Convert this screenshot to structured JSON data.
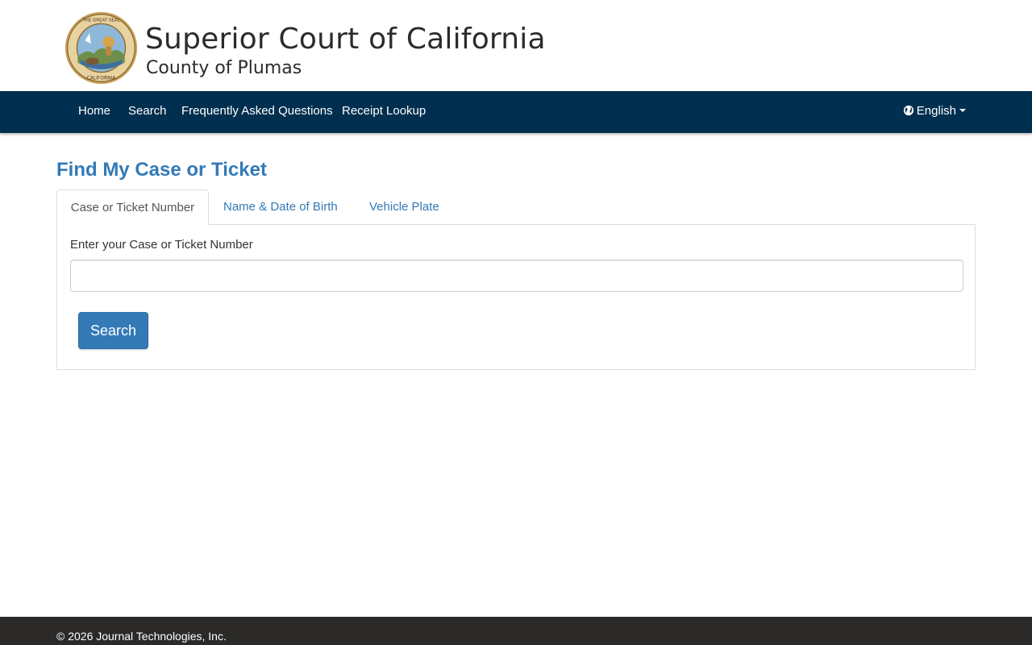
{
  "header": {
    "title": "Superior Court of California",
    "subtitle": "County of Plumas",
    "seal_icon": "california-state-seal"
  },
  "nav": {
    "items": [
      {
        "label": "Home"
      },
      {
        "label": "Search"
      },
      {
        "label": "Frequently Asked Questions"
      },
      {
        "label": "Receipt Lookup"
      }
    ],
    "language": {
      "label": "English",
      "icon": "globe-icon"
    }
  },
  "main": {
    "title": "Find My Case or Ticket",
    "tabs": [
      {
        "label": "Case or Ticket Number",
        "active": true
      },
      {
        "label": "Name & Date of Birth",
        "active": false
      },
      {
        "label": "Vehicle Plate",
        "active": false
      }
    ],
    "form": {
      "field_label": "Enter your Case or Ticket Number",
      "field_value": "",
      "field_placeholder": "",
      "search_label": "Search"
    }
  },
  "footer": {
    "copyright": "© 2026 Journal Technologies, Inc."
  },
  "colors": {
    "nav_background": "#002f4f",
    "link": "#337ab7",
    "button": "#337ab7",
    "footer_background": "#2c2a29"
  }
}
